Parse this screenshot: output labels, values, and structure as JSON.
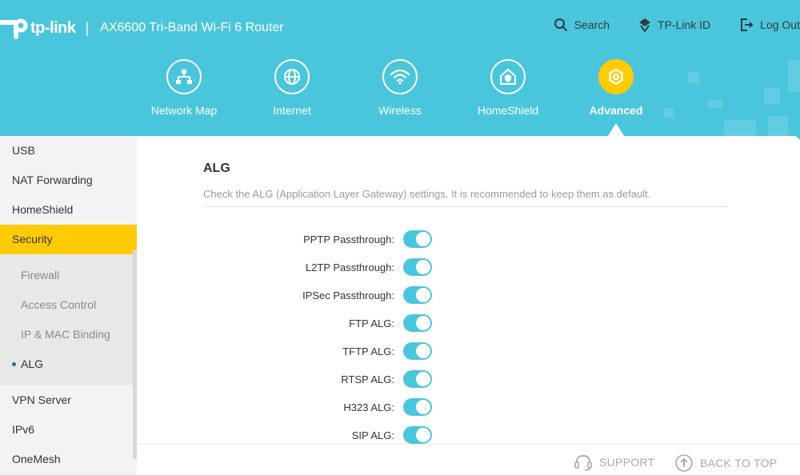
{
  "brand": {
    "logo_text": "tp-link",
    "separator": "|",
    "router_title": "AX6600 Tri-Band Wi-Fi 6 Router"
  },
  "top_links": {
    "search": "Search",
    "tplink_id": "TP-Link ID",
    "logout": "Log Out"
  },
  "nav": {
    "items": [
      {
        "label": "Network Map",
        "icon": "network-map-icon"
      },
      {
        "label": "Internet",
        "icon": "globe-icon"
      },
      {
        "label": "Wireless",
        "icon": "wifi-icon"
      },
      {
        "label": "HomeShield",
        "icon": "homeshield-icon"
      },
      {
        "label": "Advanced",
        "icon": "gear-icon",
        "active": true
      }
    ]
  },
  "sidebar": {
    "items_top": [
      "USB",
      "NAT Forwarding",
      "HomeShield"
    ],
    "active": "Security",
    "sub_items": [
      "Firewall",
      "Access Control",
      "IP & MAC Binding",
      "ALG"
    ],
    "active_sub": "ALG",
    "items_bottom": [
      "VPN Server",
      "IPv6",
      "OneMesh"
    ]
  },
  "main": {
    "title": "ALG",
    "description": "Check the ALG (Application Layer Gateway) settings. It is recommended to keep them as default.",
    "alg_items": [
      {
        "label": "PPTP Passthrough:",
        "enabled": true
      },
      {
        "label": "L2TP Passthrough:",
        "enabled": true
      },
      {
        "label": "IPSec Passthrough:",
        "enabled": true
      },
      {
        "label": "FTP ALG:",
        "enabled": true
      },
      {
        "label": "TFTP ALG:",
        "enabled": true
      },
      {
        "label": "RTSP ALG:",
        "enabled": true
      },
      {
        "label": "H323 ALG:",
        "enabled": true
      },
      {
        "label": "SIP ALG:",
        "enabled": true
      }
    ]
  },
  "footer": {
    "support": "SUPPORT",
    "back_to_top": "BACK TO TOP"
  },
  "colors": {
    "header_bg": "#4ac6dc",
    "accent": "#ffcb05",
    "toggle_on": "#4ac6dc"
  }
}
